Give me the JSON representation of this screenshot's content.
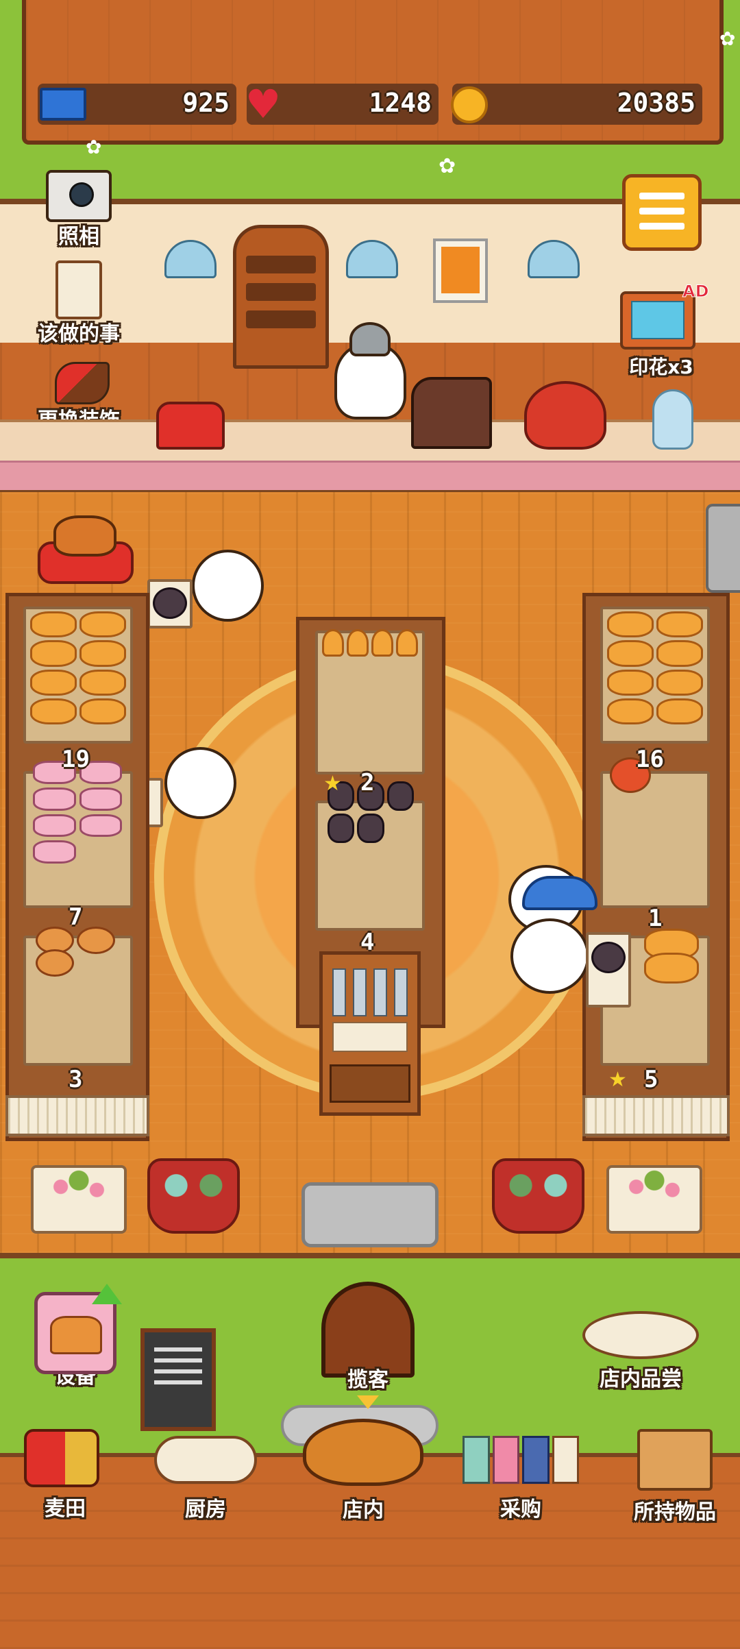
{
  "stats": {
    "tickets": "925",
    "hearts": "1248",
    "coins": "20385"
  },
  "left_menu": {
    "camera": "照相",
    "todo": "该做的事",
    "decor": "更换装饰"
  },
  "right_menu": {
    "stamp": "印花x3",
    "ad_badge": "AD"
  },
  "shelf_counts": {
    "left_middle": "19",
    "left_bottom": "7",
    "left_bottom_slot": "3",
    "center_middle": "2",
    "center_bottom": "4",
    "right_middle": "16",
    "right_bottom": "1",
    "right_bottom_slot": "5"
  },
  "actions": {
    "equipment": "设备",
    "attract": "揽客",
    "tasting": "店内品尝"
  },
  "nav": {
    "field": "麦田",
    "kitchen": "厨房",
    "store": "店内",
    "purchase": "采购",
    "items": "所持物品"
  },
  "colors": {
    "wood": "#c8682a",
    "grass": "#8cc23a",
    "floor": "#e0872f"
  }
}
